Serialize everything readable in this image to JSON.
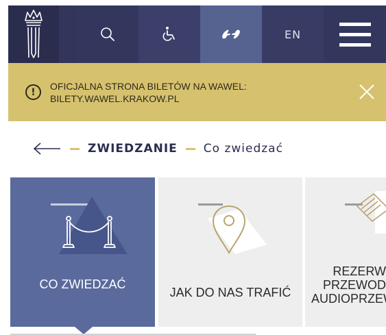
{
  "navbar": {
    "logo_icon": "wawel-crown-logo",
    "search_icon": "search-icon",
    "accessibility_icon": "wheelchair-icon",
    "sign_language_icon": "sign-language-icon",
    "language": "EN",
    "menu_icon": "hamburger-menu-icon"
  },
  "alert": {
    "text_line1": "OFICJALNA STRONA BILETÓW NA WAWEL:",
    "text_line2": "BILETY.WAWEL.KRAKOW.PL",
    "color": "#d6c26e"
  },
  "breadcrumb": {
    "section": "ZWIEDZANIE",
    "current": "Co zwiedzać"
  },
  "cards": [
    {
      "label": "CO ZWIEDZAĆ",
      "icon": "rope-barrier-icon",
      "active": true
    },
    {
      "label": "JAK DO NAS TRAFIĆ",
      "icon": "map-pin-icon",
      "active": false
    },
    {
      "label_lines": [
        "REZERW",
        "PRZEWOD",
        "AUDIOPRZEW"
      ],
      "icon": "tickets-icon",
      "active": false
    }
  ],
  "colors": {
    "navy": "#2b2d4f",
    "active_card": "#5b6a9c",
    "gold": "#d6c26e"
  }
}
